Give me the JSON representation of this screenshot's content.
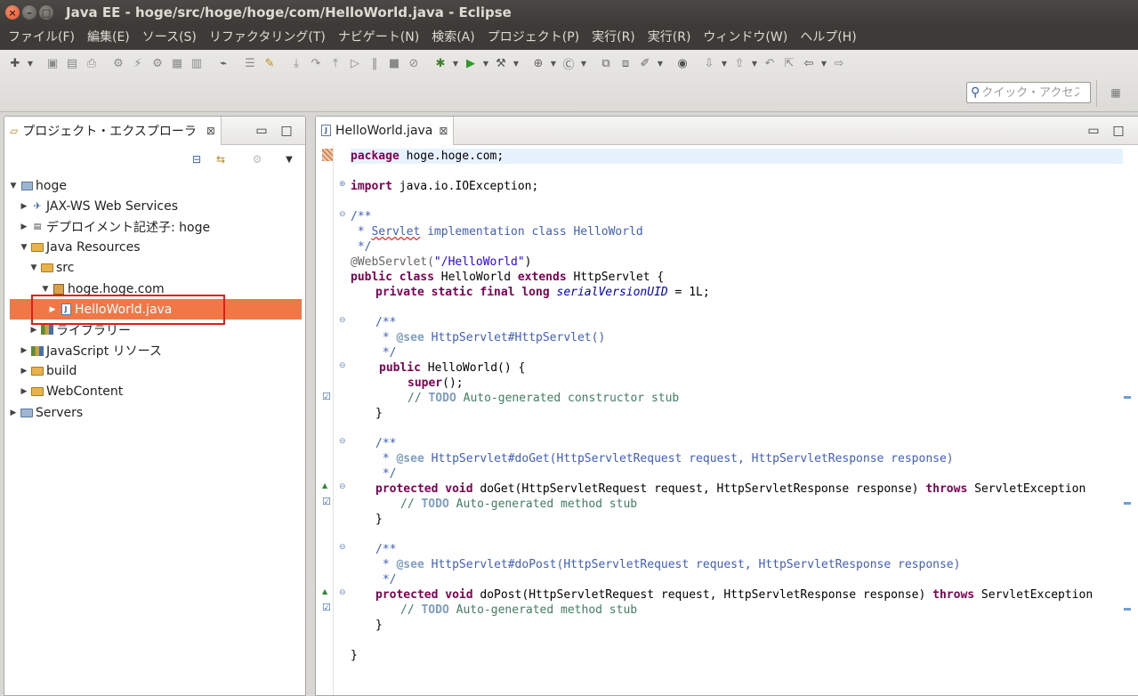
{
  "window": {
    "title": "Java EE - hoge/src/hoge/hoge/com/HelloWorld.java - Eclipse"
  },
  "menu": [
    "ファイル(F)",
    "編集(E)",
    "ソース(S)",
    "リファクタリング(T)",
    "ナビゲート(N)",
    "検索(A)",
    "プロジェクト(P)",
    "実行(R)",
    "実行(R)",
    "ウィンドウ(W)",
    "ヘルプ(H)"
  ],
  "quick_access": {
    "placeholder": "クイック・アクセス"
  },
  "explorer": {
    "tab_label": "プロジェクト・エクスプローラ",
    "tree": [
      {
        "label": "hoge",
        "level": 0,
        "expanded": true,
        "icon": "project-icon"
      },
      {
        "label": "JAX-WS Web Services",
        "level": 1,
        "expanded": false,
        "icon": "webservices-icon"
      },
      {
        "label": "デプロイメント記述子: hoge",
        "level": 1,
        "expanded": false,
        "icon": "descriptor-icon"
      },
      {
        "label": "Java Resources",
        "level": 1,
        "expanded": true,
        "icon": "java-resources-icon"
      },
      {
        "label": "src",
        "level": 2,
        "expanded": true,
        "icon": "source-folder-icon"
      },
      {
        "label": "hoge.hoge.com",
        "level": 3,
        "expanded": true,
        "icon": "package-icon"
      },
      {
        "label": "HelloWorld.java",
        "level": 4,
        "expanded": false,
        "icon": "java-file-icon",
        "selected": true
      },
      {
        "label": "ライブラリー",
        "level": 2,
        "expanded": false,
        "icon": "library-icon"
      },
      {
        "label": "JavaScript リソース",
        "level": 1,
        "expanded": false,
        "icon": "javascript-icon"
      },
      {
        "label": "build",
        "level": 1,
        "expanded": false,
        "icon": "folder-icon"
      },
      {
        "label": "WebContent",
        "level": 1,
        "expanded": false,
        "icon": "folder-icon"
      },
      {
        "label": "Servers",
        "level": 0,
        "expanded": false,
        "icon": "folder-icon"
      }
    ]
  },
  "editor": {
    "tab_label": "HelloWorld.java",
    "code": {
      "package_kw": "package",
      "package_name": " hoge.hoge.com;",
      "import_kw": "import",
      "import_name": " java.io.IOException;",
      "jd1_open": "/**",
      "jd1_body_pre": " * ",
      "jd1_servlet": "Servlet",
      "jd1_body_post": " implementation class HelloWorld",
      "jd1_close": " */",
      "anno": "@WebServlet(",
      "anno_str": "\"/HelloWorld\"",
      "anno_close": ")",
      "class_public": "public",
      "class_class": "class",
      "class_name": " HelloWorld ",
      "class_extends": "extends",
      "class_super": " HttpServlet {",
      "field_mods": "private static final long",
      "field_name": "serialVersionUID",
      "field_val": " = 1L;",
      "jd2_open": "/**",
      "jd2_tag": "@see",
      "jd2_ref": " HttpServlet#HttpServlet()",
      "jd2_close": " */",
      "ctor_public": "public",
      "ctor_sig": " HelloWorld() {",
      "super_kw": "super",
      "super_rest": "();",
      "todo1_pre": "// ",
      "todo_tag": "TODO",
      "todo1_rest": " Auto-generated constructor stub",
      "close_brace": "}",
      "jd3_open": "/**",
      "jd3_tag": "@see",
      "jd3_ref": " HttpServlet#doGet(HttpServletRequest request, HttpServletResponse response)",
      "jd3_close": " */",
      "doget_mods": "protected void",
      "doget_sig": " doGet(HttpServletRequest request, HttpServletResponse response) ",
      "throws_kw": "throws",
      "exc": " ServletException",
      "todo2_rest": " Auto-generated method stub",
      "jd4_open": "/**",
      "jd4_tag": "@see",
      "jd4_ref": " HttpServlet#doPost(HttpServletRequest request, HttpServletResponse response)",
      "jd4_close": " */",
      "dopost_mods": "protected void",
      "dopost_sig": " doPost(HttpServletRequest request, HttpServletResponse response) ",
      "exc2": " ServletException",
      "class_close": "}"
    }
  },
  "colors": {
    "selection": "#f07746",
    "highlight_box": "#e41b1b",
    "keyword": "#7f0055",
    "javadoc": "#3f5fbf",
    "comment": "#3f7f5f",
    "string": "#2a00ff"
  }
}
